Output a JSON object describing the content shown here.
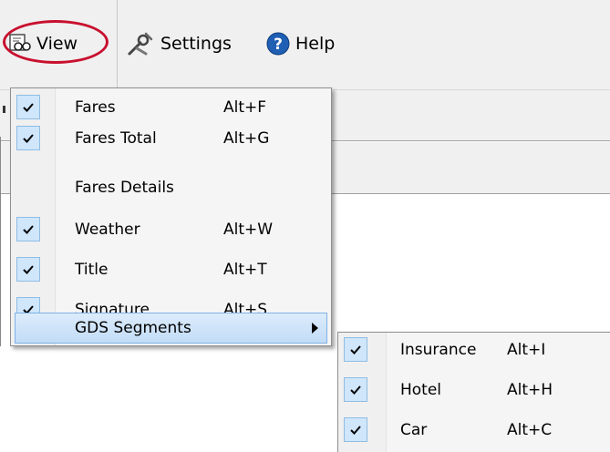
{
  "toolbar": {
    "view_label": "View",
    "settings_label": "Settings",
    "help_label": "Help"
  },
  "view_menu": {
    "items": [
      {
        "label": "Fares",
        "shortcut": "Alt+F",
        "checked": true
      },
      {
        "label": "Fares Total",
        "shortcut": "Alt+G",
        "checked": true
      },
      {
        "label": "Fares Details",
        "shortcut": "",
        "checked": false
      },
      {
        "label": "Weather",
        "shortcut": "Alt+W",
        "checked": true
      },
      {
        "label": "Title",
        "shortcut": "Alt+T",
        "checked": true
      },
      {
        "label": "Signature",
        "shortcut": "Alt+S",
        "checked": true
      },
      {
        "label": "GDS Segments",
        "shortcut": "",
        "checked": false,
        "submenu": true,
        "highlighted": true
      }
    ]
  },
  "gds_submenu": {
    "items": [
      {
        "label": "Insurance",
        "shortcut": "Alt+I",
        "checked": true
      },
      {
        "label": "Hotel",
        "shortcut": "Alt+H",
        "checked": true
      },
      {
        "label": "Car",
        "shortcut": "Alt+C",
        "checked": true
      }
    ]
  },
  "colors": {
    "highlight_ring": "#c8102e",
    "menu_highlight": "#c2dcf6",
    "check_bg": "#cfe6fb",
    "help_icon": "#1f5fb4"
  },
  "icons": {
    "view": "binoculars-icon",
    "settings": "wrench-icon",
    "help": "question-circle-icon",
    "check": "check-icon",
    "submenu": "submenu-arrow-icon"
  }
}
